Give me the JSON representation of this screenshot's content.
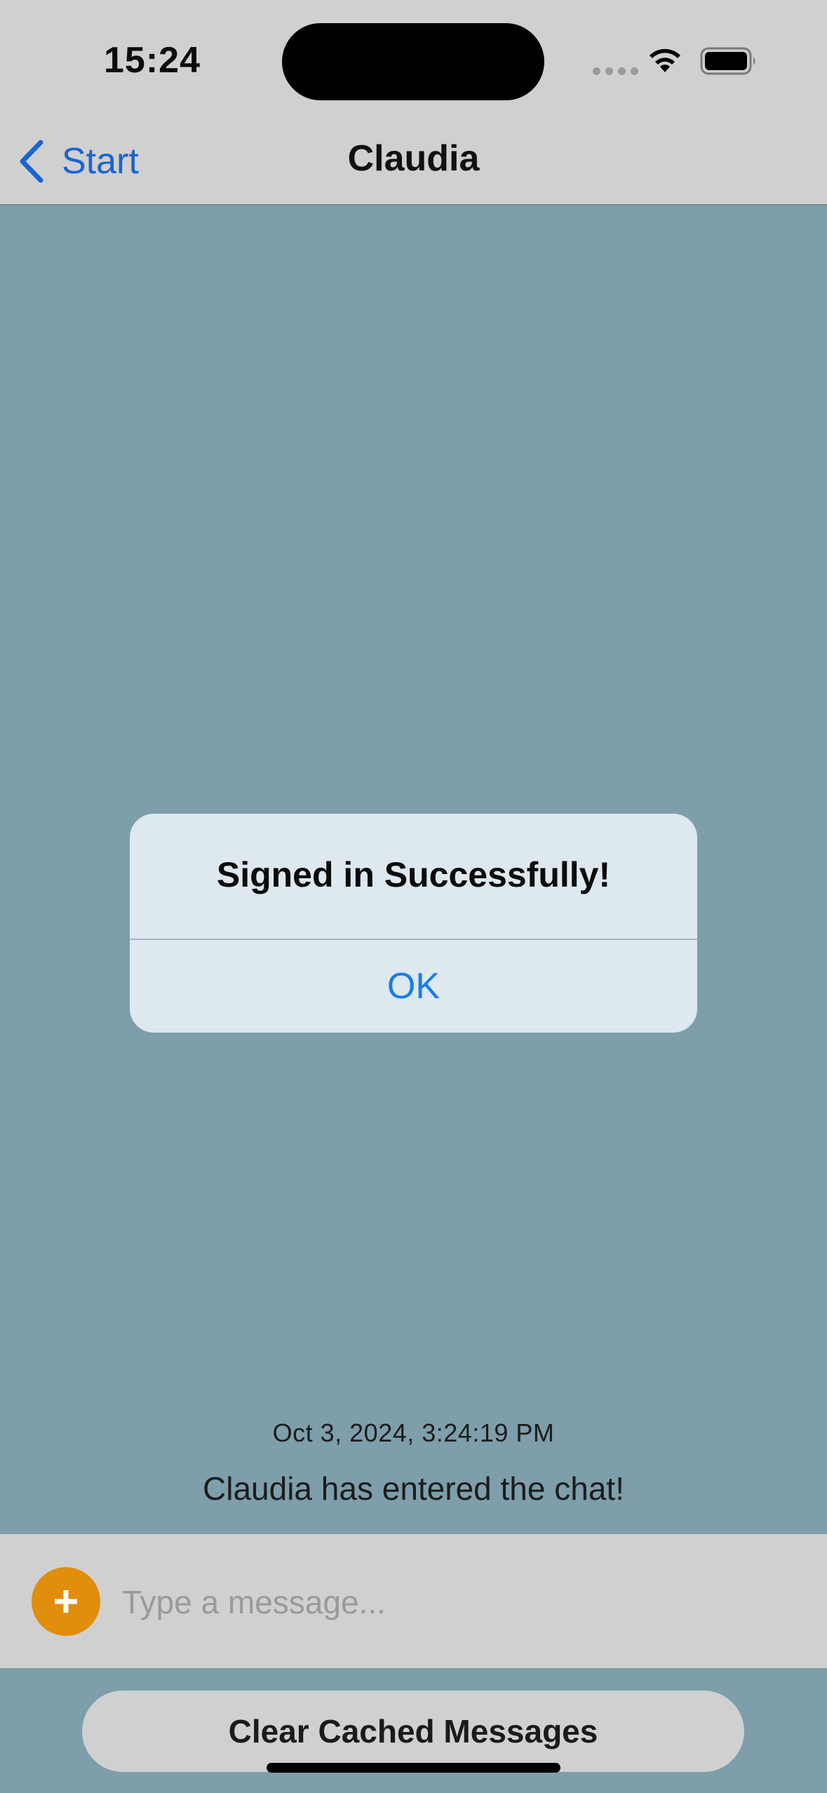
{
  "status_bar": {
    "time": "15:24",
    "icons": [
      "cellular-signal-icon",
      "wifi-icon",
      "battery-icon"
    ]
  },
  "nav": {
    "back_label": "Start",
    "title": "Claudia"
  },
  "chat": {
    "messages": [
      {
        "timestamp": "Oct 3, 2024, 3:24:19 PM",
        "text": "Claudia has entered the chat!"
      }
    ]
  },
  "input": {
    "placeholder": "Type a message...",
    "value": ""
  },
  "actions": {
    "clear_label": "Clear Cached Messages"
  },
  "alert": {
    "title": "Signed in Successfully!",
    "ok_label": "OK"
  },
  "colors": {
    "background": "#7d9eaa",
    "bars": "#d0d0d0",
    "accent_blue": "#1a64d1",
    "add_button": "#e08e0b",
    "alert_bg": "#dde8ef",
    "alert_button": "#1a7de6"
  }
}
